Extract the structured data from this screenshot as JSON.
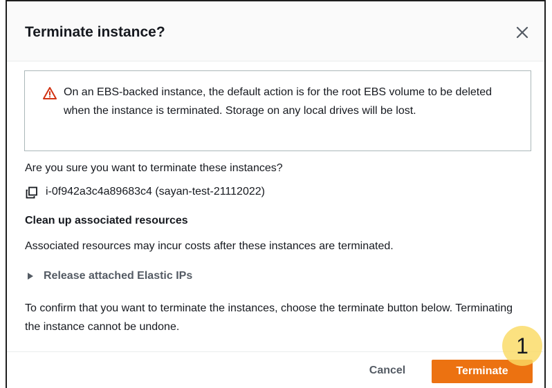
{
  "dialog": {
    "title": "Terminate instance?",
    "close_icon": "close-icon"
  },
  "alert": {
    "icon": "warning-icon",
    "icon_color": "#d13212",
    "text": "On an EBS-backed instance, the default action is for the root EBS volume to be deleted when the instance is terminated. Storage on any local drives will be lost."
  },
  "body": {
    "question": "Are you sure you want to terminate these instances?",
    "instance_label": "i-0f942a3c4a89683c4 (sayan-test-21112022)",
    "copy_icon": "copy-icon",
    "cleanup_heading": "Clean up associated resources",
    "cleanup_text": "Associated resources may incur costs after these instances are terminated.",
    "expander_label": "Release attached Elastic IPs",
    "confirm_text": "To confirm that you want to terminate the instances, choose the terminate button below. Terminating the instance cannot be undone."
  },
  "footer": {
    "cancel_label": "Cancel",
    "terminate_label": "Terminate",
    "accent_color": "#ec7211"
  },
  "annotation": {
    "step_number": "1"
  }
}
